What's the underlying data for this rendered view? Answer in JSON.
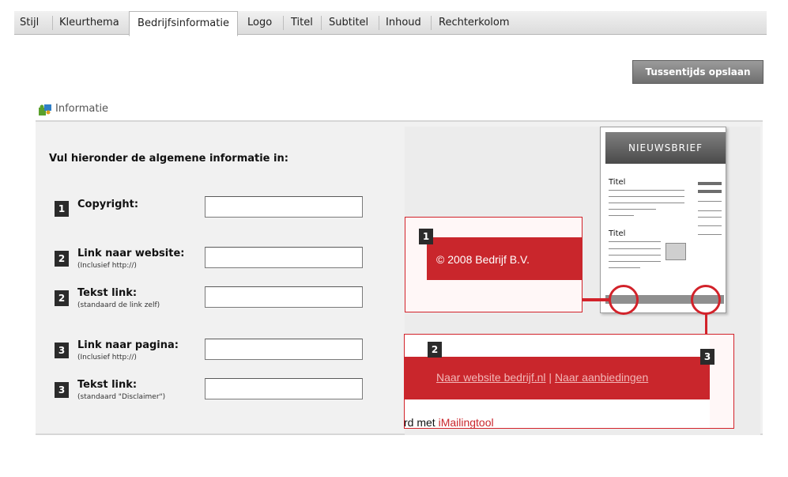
{
  "tabs": [
    {
      "label": "Stijl",
      "active": false
    },
    {
      "label": "Kleurthema",
      "active": false
    },
    {
      "label": "Bedrijfsinformatie",
      "active": true
    },
    {
      "label": "Logo",
      "active": false
    },
    {
      "label": "Titel",
      "active": false
    },
    {
      "label": "Subtitel",
      "active": false
    },
    {
      "label": "Inhoud",
      "active": false
    },
    {
      "label": "Rechterkolom",
      "active": false
    }
  ],
  "toolbar": {
    "save_label": "Tussentijds opslaan"
  },
  "section": {
    "icon": "puzzle-icon",
    "title": "Informatie"
  },
  "form": {
    "intro": "Vul hieronder de algemene informatie in:",
    "fields": [
      {
        "number": "1",
        "label": "Copyright:",
        "hint": "",
        "value": ""
      },
      {
        "number": "2",
        "label": "Link naar website:",
        "hint": "(Inclusief http://)",
        "value": ""
      },
      {
        "number": "2",
        "label": "Tekst link:",
        "hint": "(standaard de link zelf)",
        "value": ""
      },
      {
        "number": "3",
        "label": "Link naar pagina:",
        "hint": "(Inclusief http://)",
        "value": ""
      },
      {
        "number": "3",
        "label": "Tekst link:",
        "hint": "(standaard \"Disclaimer\")",
        "value": ""
      }
    ]
  },
  "illustration": {
    "newsletter_header": "NIEUWSBRIEF",
    "doc_title_1": "Titel",
    "doc_title_2": "Titel",
    "callout1": {
      "number": "1",
      "text": "© 2008 Bedrijf B.V."
    },
    "callout2": {
      "number": "2",
      "link1": "Naar website bedrijf.nl",
      "separator": " | ",
      "link2": "Naar aanbiedingen"
    },
    "callout3": {
      "number": "3"
    },
    "credit_prefix": "rd met ",
    "credit_brand": "iMailingtool"
  },
  "colors": {
    "accent": "#c9262c",
    "tab_bg": "#e3e3e3",
    "panel_bg": "#f1f1f1",
    "button_bg": "#888888"
  }
}
